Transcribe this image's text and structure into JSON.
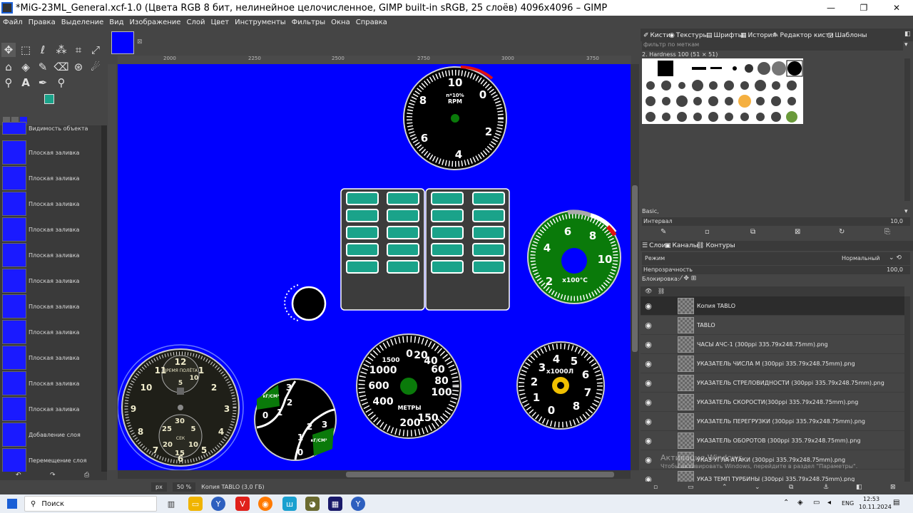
{
  "window": {
    "title": "*MiG-23ML_General.xcf-1.0 (Цвета RGB 8 бит, нелинейное целочисленное, GIMP built-in sRGB, 25 слоёв) 4096x4096 – GIMP"
  },
  "menu": [
    "Файл",
    "Правка",
    "Выделение",
    "Вид",
    "Изображение",
    "Слой",
    "Цвет",
    "Инструменты",
    "Фильтры",
    "Окна",
    "Справка"
  ],
  "colors": {
    "fg": "#1aa38a",
    "bg": "#000000",
    "canvas": "#0000ff"
  },
  "history": {
    "top_label": "Видимость объекта",
    "items": [
      "Плоская заливка",
      "Плоская заливка",
      "Плоская заливка",
      "Плоская заливка",
      "Плоская заливка",
      "Плоская заливка",
      "Плоская заливка",
      "Плоская заливка",
      "Плоская заливка",
      "Плоская заливка",
      "Плоская заливка",
      "Добавление слоя",
      "Перемещение слоя",
      "Перемещение слоя"
    ]
  },
  "ruler": {
    "marks": [
      "2000",
      "2250",
      "2500",
      "2750",
      "3000",
      "3250",
      "3500",
      "3750"
    ]
  },
  "status": {
    "unit": "px",
    "zoom": "50 %",
    "layer_info": "Копия TABLO (3,0 ГБ)"
  },
  "brushes_panel": {
    "tabs": [
      "Кисти",
      "Текстуры",
      "Шрифты",
      "История",
      "Редактор кисти",
      "Шаблоны"
    ],
    "filter_placeholder": "фильтр по меткам",
    "selected_brush": "2. Hardness 100 (51 × 51)",
    "preset": "Basic,",
    "spacing_label": "Интервал",
    "spacing_value": "10,0"
  },
  "layers_panel": {
    "tabs": [
      "Слои",
      "Каналы",
      "Контуры"
    ],
    "mode_label": "Режим",
    "mode_value": "Нормальный",
    "opacity_label": "Непрозрачность",
    "opacity_value": "100,0",
    "lock_label": "Блокировка:",
    "layers": [
      "Копия TABLO",
      "TABLO",
      "ЧАСЫ АЧС-1 (300ppi 335.79x248.75mm).png",
      "УКАЗАТЕЛЬ ЧИСЛА М (300ppi 335.79x248.75mm).png",
      "УКАЗАТЕЛЬ СТРЕЛОВИДНОСТИ (300ppi 335.79x248.75mm).png",
      "УКАЗАТЕЛЬ СКОРОСТИ(300ppi 335.79x248.75mm).png",
      "УКАЗАТЕЛЬ ПЕРЕГРУЗКИ (300ppi 335.79x248.75mm).png",
      "УКАЗАТЕЛЬ ОБОРОТОВ (300ppi 335.79x248.75mm).png",
      "УКАЗ УГЛА АТАКИ (300ppi 335.79x248.75mm).png",
      "УКАЗ ТЕМП ТУРБИНЫ (300ppi 335.79x248.75mm).png"
    ]
  },
  "watermark": {
    "line1": "Активация Windows",
    "line2": "Чтобы активировать Windows, перейдите в раздел \"Параметры\"."
  },
  "taskbar": {
    "search": "Поиск",
    "lang": "ENG",
    "time": "12:53",
    "date": "10.11.2024"
  },
  "gauges": {
    "rpm": {
      "ticks": [
        "10",
        "8",
        "6",
        "4",
        "2",
        "0"
      ],
      "unit1": "n*10%",
      "unit2": "RPM"
    },
    "temp": {
      "ticks": [
        "6",
        "4",
        "2",
        "8",
        "10"
      ],
      "unit": "x100°C"
    },
    "altitude": {
      "ticks": [
        "0",
        "20",
        "40",
        "60",
        "80",
        "100",
        "150",
        "200",
        "400",
        "600",
        "1000",
        "1500"
      ],
      "unit": "МЕТРЫ"
    },
    "fuel": {
      "ticks": [
        "4",
        "5",
        "3",
        "6",
        "2",
        "7",
        "1",
        "0",
        "8"
      ],
      "unit": "x1000Л"
    },
    "clock": {
      "ticks": [
        "10",
        "11",
        "12",
        "1",
        "2",
        "9",
        "3",
        "8",
        "4",
        "7",
        "5",
        "6"
      ],
      "sub": [
        "30",
        "25",
        "5",
        "20",
        "15",
        "10",
        "5",
        "10"
      ],
      "label": "ВРЕМЯ ПОЛЁТА",
      "sec": "СЕК"
    },
    "pressure": {
      "ticks_a": [
        "3",
        "2",
        "1",
        "0"
      ],
      "ticks_b": [
        "3",
        "2",
        "1",
        "0"
      ],
      "unit_a": "кГ/СМ²",
      "unit_b": "кГ/СМ²"
    }
  }
}
